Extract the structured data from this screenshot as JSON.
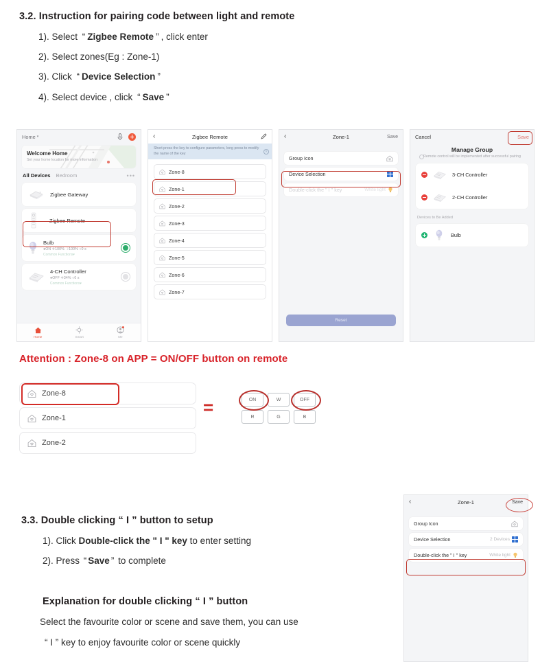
{
  "doc": {
    "section_32": {
      "heading": "3.2. Instruction for pairing code between light and remote",
      "steps": [
        {
          "num": "1). Select",
          "q1": "“",
          "bold": "Zigbee Remote",
          "q2": "”",
          "tail": ", click enter"
        },
        {
          "num": "2). Select zones(Eg : Zone-1)",
          "q1": "",
          "bold": "",
          "q2": "",
          "tail": ""
        },
        {
          "num": "3). Click",
          "q1": "“",
          "bold": "Device Selection",
          "q2": "”",
          "tail": ""
        },
        {
          "num": "4). Select device , click",
          "q1": "“",
          "bold": "Save",
          "q2": "”",
          "tail": ""
        }
      ]
    },
    "attention": "Attention : Zone-8 on APP = ON/OFF button on remote",
    "section_33": {
      "heading": "3.3. Double clicking “ I ” button to setup",
      "step1_pre": "1). Click",
      "step1_bold": "Double-click the \" I \" key",
      "step1_post": "to enter setting",
      "step2_pre": "2). Press",
      "step2_q1": "“",
      "step2_bold": "Save",
      "step2_q2": "”",
      "step2_post": "to complete",
      "explanation_heading": "Explanation for double clicking “ I ” button",
      "explanation_line1": "Select the favourite color or scene and save them, you can use",
      "explanation_line2": "“ I ”  key to enjoy favourite color or scene quickly"
    }
  },
  "phone1": {
    "header": {
      "home_label": "Home",
      "caret": "▾",
      "mic_icon": "microphone-icon",
      "add_icon": "plus-icon"
    },
    "banner": {
      "title": "Welcome Home",
      "subtitle": "Set your home location for more information"
    },
    "tabs": {
      "active": "All Devices",
      "other": "Bedroom",
      "more": "•••"
    },
    "devices": [
      {
        "name": "Zigbee Gateway",
        "status": "",
        "common": "",
        "toggle": "none",
        "icon": "gateway-icon"
      },
      {
        "name": "Zigbee Remote",
        "status": "",
        "common": "",
        "toggle": "none",
        "icon": "remote-icon"
      },
      {
        "name": "Bulb",
        "status": "●ON   ✛100%   ☽100%   ○0 s",
        "common": "Common Functions▾",
        "toggle": "on",
        "icon": "bulb-icon"
      },
      {
        "name": "4-CH Controller",
        "status": "●OFF   ✛34%   ○0 s",
        "common": "Common Functions▾",
        "toggle": "off",
        "icon": "controller-icon"
      }
    ],
    "nav": [
      {
        "label": "Home",
        "icon": "home-icon",
        "active": true
      },
      {
        "label": "Smart",
        "icon": "sun-icon",
        "active": false
      },
      {
        "label": "Me",
        "icon": "person-icon",
        "active": false
      }
    ]
  },
  "phone2": {
    "back_icon": "chevron-left-icon",
    "title": "Zigbee Remote",
    "edit_icon": "pencil-icon",
    "tip": "Short press the key to configure parameters, long press to modify the name of the key",
    "tip_close": "close-icon",
    "zones": [
      "Zone-8",
      "Zone-1",
      "Zone-2",
      "Zone-3",
      "Zone-4",
      "Zone-5",
      "Zone-6",
      "Zone-7"
    ],
    "highlighted_zone": "Zone-1"
  },
  "phone3": {
    "back_icon": "chevron-left-icon",
    "title": "Zone-1",
    "save": "Save",
    "rows": [
      {
        "label": "Group Icon",
        "value": "",
        "icon": "home-outline-icon",
        "muted": false
      },
      {
        "label": "Device Selection",
        "value": "",
        "icon": "grid-icon",
        "muted": false
      },
      {
        "label": "Double-click the \" I \" key",
        "value": "White light",
        "icon": "bulb-small-icon",
        "muted": true
      }
    ],
    "reset_label": "Reset"
  },
  "phone4": {
    "cancel": "Cancel",
    "save": "Save",
    "title": "Manage Group",
    "subtitle": "Remote control will be implemented after successful pairing",
    "info_icon": "info-icon",
    "group_devices": [
      {
        "name": "3-CH Controller",
        "action": "remove",
        "icon": "controller-icon"
      },
      {
        "name": "2-CH Controller",
        "action": "remove",
        "icon": "controller-icon"
      }
    ],
    "to_be_added_label": "Devices to Be Added",
    "to_be_added": [
      {
        "name": "Bulb",
        "action": "add",
        "icon": "bulb-icon"
      }
    ]
  },
  "phone5": {
    "back_icon": "chevron-left-icon",
    "title": "Zone-1",
    "save": "Save",
    "rows": [
      {
        "label": "Group Icon",
        "value": "",
        "icon": "home-outline-icon"
      },
      {
        "label": "Device Selection",
        "value": "2 Devices",
        "icon": "grid-icon"
      },
      {
        "label": "Double-click the \" I \" key",
        "value": "White light",
        "icon": "bulb-small-icon"
      }
    ]
  },
  "attention_diagram": {
    "zones": [
      "Zone-8",
      "Zone-1",
      "Zone-2"
    ],
    "equals": "=",
    "keys_row1": [
      "ON",
      "W",
      "OFF"
    ],
    "keys_row2": [
      "R",
      "G",
      "B"
    ],
    "circled_keys": [
      "ON",
      "OFF"
    ]
  },
  "colors": {
    "accent_red": "#d8232a",
    "annotation_red": "#c0392f",
    "brand_orange": "#e8503a",
    "tip_blue": "#dbe6f2",
    "reset_purple": "#9aa4d1",
    "toggle_green": "#2dad6b",
    "grid_blue": "#2f6fd0"
  }
}
